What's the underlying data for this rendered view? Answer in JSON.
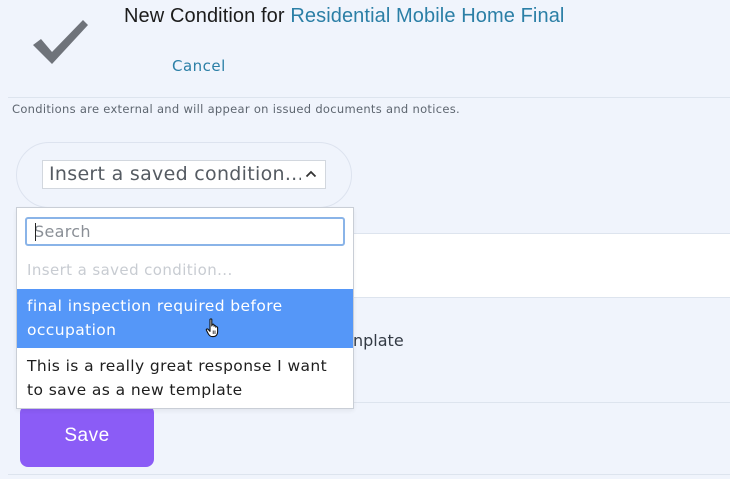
{
  "header": {
    "title_prefix": "New Condition for ",
    "title_link": "Residential Mobile Home Final",
    "cancel_label": "Cancel",
    "check_icon": "checkmark-icon"
  },
  "subtitle": "Conditions are external and will appear on issued documents and notices.",
  "condition_select": {
    "selected_value": "Insert a saved condition...",
    "chevron_icon": "chevron-up-icon"
  },
  "dropdown": {
    "search_placeholder": "Search",
    "search_value": "",
    "options": [
      {
        "label": "Insert a saved condition...",
        "state": "disabled"
      },
      {
        "label": "final inspection required before occupation",
        "state": "highlighted"
      },
      {
        "label": "This is a really great response I want to save as a new template",
        "state": "normal"
      }
    ]
  },
  "background_text": "nplate",
  "save_label": "Save",
  "colors": {
    "accent_link": "#2b7fa6",
    "highlight": "#5597f8",
    "save_button": "#8b5cf6",
    "page_bg": "#f0f4fc"
  }
}
